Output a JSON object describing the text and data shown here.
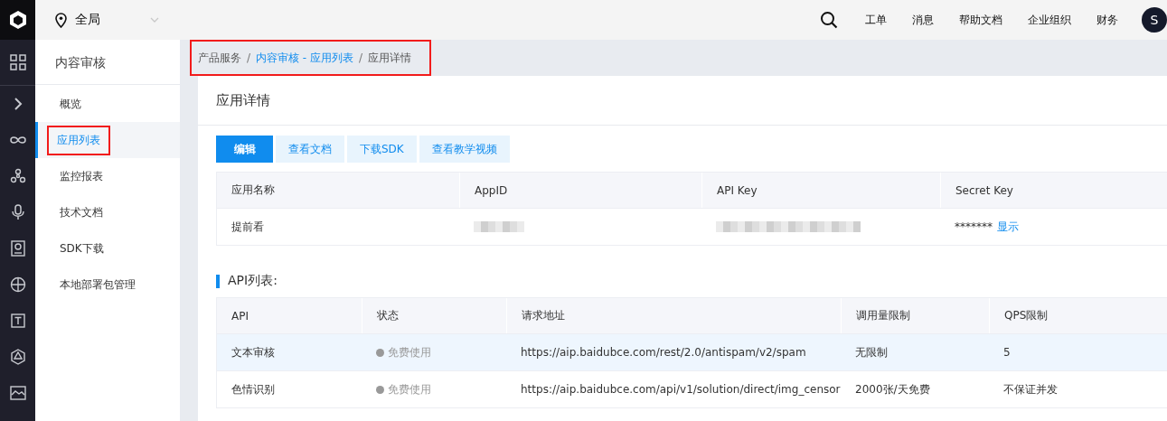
{
  "header": {
    "region": "全局",
    "links": [
      "工单",
      "消息",
      "帮助文档",
      "企业组织",
      "财务"
    ],
    "avatar": "S"
  },
  "rail": {
    "icons": [
      {
        "kind": "grid"
      },
      {
        "kind": "chevron"
      },
      {
        "kind": "infinity"
      },
      {
        "kind": "nodes"
      },
      {
        "kind": "mic"
      },
      {
        "kind": "chip"
      },
      {
        "kind": "globe"
      },
      {
        "kind": "text"
      },
      {
        "kind": "hex"
      },
      {
        "kind": "image"
      }
    ]
  },
  "sidebar": {
    "title": "内容审核",
    "items": [
      {
        "label": "概览",
        "selected": false,
        "highlighted": false
      },
      {
        "label": "应用列表",
        "selected": true,
        "highlighted": true
      },
      {
        "label": "监控报表",
        "selected": false,
        "highlighted": false
      },
      {
        "label": "技术文档",
        "selected": false,
        "highlighted": false
      },
      {
        "label": "SDK下载",
        "selected": false,
        "highlighted": false
      },
      {
        "label": "本地部署包管理",
        "selected": false,
        "highlighted": false
      }
    ]
  },
  "breadcrumb": {
    "highlighted": true,
    "separator": "/",
    "items": [
      {
        "label": "产品服务",
        "link": false
      },
      {
        "label": "内容审核 - 应用列表",
        "link": true
      },
      {
        "label": "应用详情",
        "link": false
      }
    ]
  },
  "page": {
    "title": "应用详情",
    "buttons": [
      {
        "label": "编辑",
        "primary": true
      },
      {
        "label": "查看文档",
        "primary": false
      },
      {
        "label": "下载SDK",
        "primary": false
      },
      {
        "label": "查看教学视频",
        "primary": false
      }
    ]
  },
  "app_table": {
    "columns": [
      "应用名称",
      "AppID",
      "API Key",
      "Secret Key"
    ],
    "row": {
      "name": "提前看",
      "app_id": {
        "kind": "redacted"
      },
      "api_key": {
        "kind": "redacted"
      },
      "secret": "*******",
      "show_link": "显示"
    }
  },
  "api_section": {
    "title": "API列表:",
    "columns": [
      "API",
      "状态",
      "请求地址",
      "调用量限制",
      "QPS限制"
    ],
    "rows": [
      {
        "api": "文本审核",
        "status": "免费使用",
        "url": "https://aip.baidubce.com/rest/2.0/antispam/v2/spam",
        "limit": "无限制",
        "qps": "5",
        "hovered": true
      },
      {
        "api": "色情识别",
        "status": "免费使用",
        "url": "https://aip.baidubce.com/api/v1/solution/direct/img_censor",
        "limit": "2000张/天免费",
        "qps": "不保证并发",
        "hovered": false
      }
    ]
  }
}
